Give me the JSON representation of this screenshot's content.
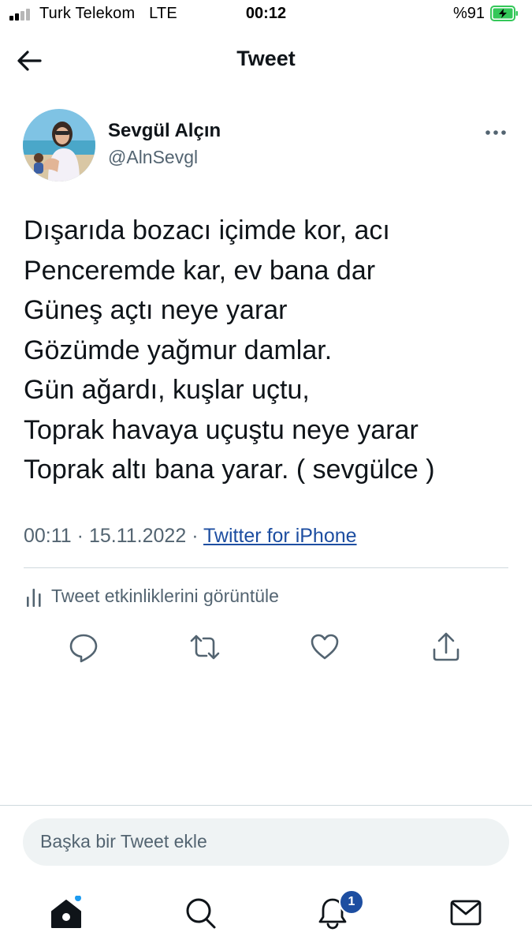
{
  "status_bar": {
    "carrier": "Turk Telekom",
    "network": "LTE",
    "time": "00:12",
    "battery_percent": "%91",
    "battery_level": 0.91,
    "signal_bars": 2
  },
  "nav": {
    "title": "Tweet"
  },
  "author": {
    "display_name": "Sevgül Alçın",
    "handle": "@AlnSevgl"
  },
  "tweet": {
    "lines": [
      "Dışarıda bozacı içimde kor, acı",
      "Penceremde kar, ev bana dar",
      "Güneş açtı neye yarar",
      "Gözümde yağmur damlar.",
      "Gün ağardı, kuşlar uçtu,",
      "Toprak havaya uçuştu neye yarar",
      "Toprak altı bana yarar. ( sevgülce )"
    ],
    "time": "00:11",
    "date": "15.11.2022",
    "separator": "·",
    "source": "Twitter for iPhone"
  },
  "analytics": {
    "label": "Tweet etkinliklerini görüntüle"
  },
  "actions": [
    "reply-icon",
    "retweet-icon",
    "like-icon",
    "share-icon"
  ],
  "reply": {
    "placeholder": "Başka bir Tweet ekle"
  },
  "tab_bar": {
    "items": [
      "home-icon",
      "search-icon",
      "notifications-icon",
      "messages-icon"
    ],
    "notification_count": "1"
  },
  "colors": {
    "text": "#0f1419",
    "secondary": "#536471",
    "link": "#1d4ea1",
    "accent": "#1d9bf0",
    "battery_green": "#34c759",
    "divider": "#cfd9de"
  }
}
